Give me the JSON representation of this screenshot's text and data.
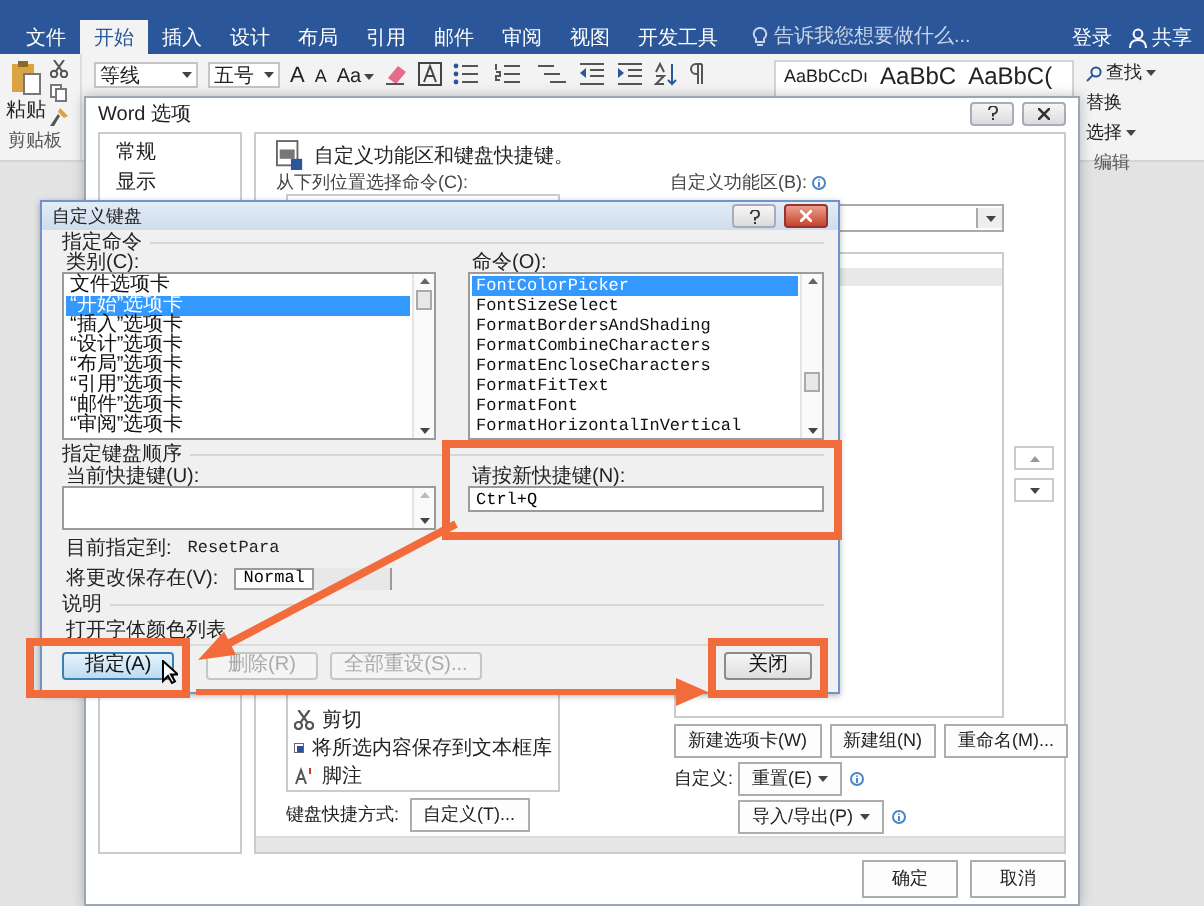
{
  "word_window": {
    "tabs": [
      {
        "label": "文件",
        "selected": false
      },
      {
        "label": "开始",
        "selected": true
      },
      {
        "label": "插入",
        "selected": false
      },
      {
        "label": "设计",
        "selected": false
      },
      {
        "label": "布局",
        "selected": false
      },
      {
        "label": "引用",
        "selected": false
      },
      {
        "label": "邮件",
        "selected": false
      },
      {
        "label": "审阅",
        "selected": false
      },
      {
        "label": "视图",
        "selected": false
      },
      {
        "label": "开发工具",
        "selected": false
      }
    ],
    "tell_me": {
      "placeholder": "告诉我您想要做什么..."
    },
    "sign_in": "登录",
    "share": "共享",
    "ribbon": {
      "paste": "粘贴",
      "clipboard_label": "剪贴板",
      "font_name": "等线",
      "font_size": "五号",
      "font_buttons": [
        "A",
        "A"
      ],
      "case_button": "Aa",
      "styles": [
        "AaBbCcDı",
        "AaBbC",
        "AaBbC("
      ],
      "find": "查找",
      "replace": "替换",
      "select": "选择",
      "editing_label": "编辑"
    }
  },
  "options_dialog": {
    "title": "Word 选项",
    "nav": [
      {
        "label": "常规",
        "selected": false
      },
      {
        "label": "显示",
        "selected": false
      }
    ],
    "heading": "自定义功能区和键盘快捷键。",
    "choose_label": "从下列位置选择命令(C):",
    "ribbon_label": "自定义功能区(B):",
    "commands": [
      "剪切",
      "将所选内容保存到文本框库",
      "脚注"
    ],
    "keyboard_label": "键盘快捷方式:",
    "keyboard_button": "自定义(T)...",
    "tab_buttons": [
      "新建选项卡(W)",
      "新建组(N)",
      "重命名(M)..."
    ],
    "customize_label": "自定义:",
    "reset_button": "重置(E)",
    "import_export_button": "导入/导出(P)",
    "ok": "确定",
    "cancel": "取消"
  },
  "keyboard_dialog": {
    "title": "自定义键盘",
    "specify_group": "指定命令",
    "categories_label": "类别(C):",
    "categories": [
      {
        "label": "文件选项卡",
        "selected": false
      },
      {
        "label": "“开始”选项卡",
        "selected": true
      },
      {
        "label": "“插入”选项卡",
        "selected": false
      },
      {
        "label": "“设计”选项卡",
        "selected": false
      },
      {
        "label": "“布局”选项卡",
        "selected": false
      },
      {
        "label": "“引用”选项卡",
        "selected": false
      },
      {
        "label": "“邮件”选项卡",
        "selected": false
      },
      {
        "label": "“审阅”选项卡",
        "selected": false
      }
    ],
    "commands_label": "命令(O):",
    "commands": [
      {
        "label": "FontColorPicker",
        "selected": true
      },
      {
        "label": "FontSizeSelect",
        "selected": false
      },
      {
        "label": "FormatBordersAndShading",
        "selected": false
      },
      {
        "label": "FormatCombineCharacters",
        "selected": false
      },
      {
        "label": "FormatEncloseCharacters",
        "selected": false
      },
      {
        "label": "FormatFitText",
        "selected": false
      },
      {
        "label": "FormatFont",
        "selected": false
      },
      {
        "label": "FormatHorizontalInVertical",
        "selected": false
      }
    ],
    "sequence_group": "指定键盘顺序",
    "current_keys_label": "当前快捷键(U):",
    "new_key_label": "请按新快捷键(N):",
    "new_key_value": "Ctrl+Q",
    "assigned_label": "目前指定到:",
    "assigned_value": "ResetPara",
    "save_in_label": "将更改保存在(V):",
    "save_in_value": "Normal",
    "description_group": "说明",
    "description": "打开字体颜色列表",
    "buttons": [
      {
        "label": "指定(A)",
        "disabled": false
      },
      {
        "label": "删除(R)",
        "disabled": true
      },
      {
        "label": "全部重设(S)...",
        "disabled": true
      }
    ],
    "close_button": "关闭"
  }
}
